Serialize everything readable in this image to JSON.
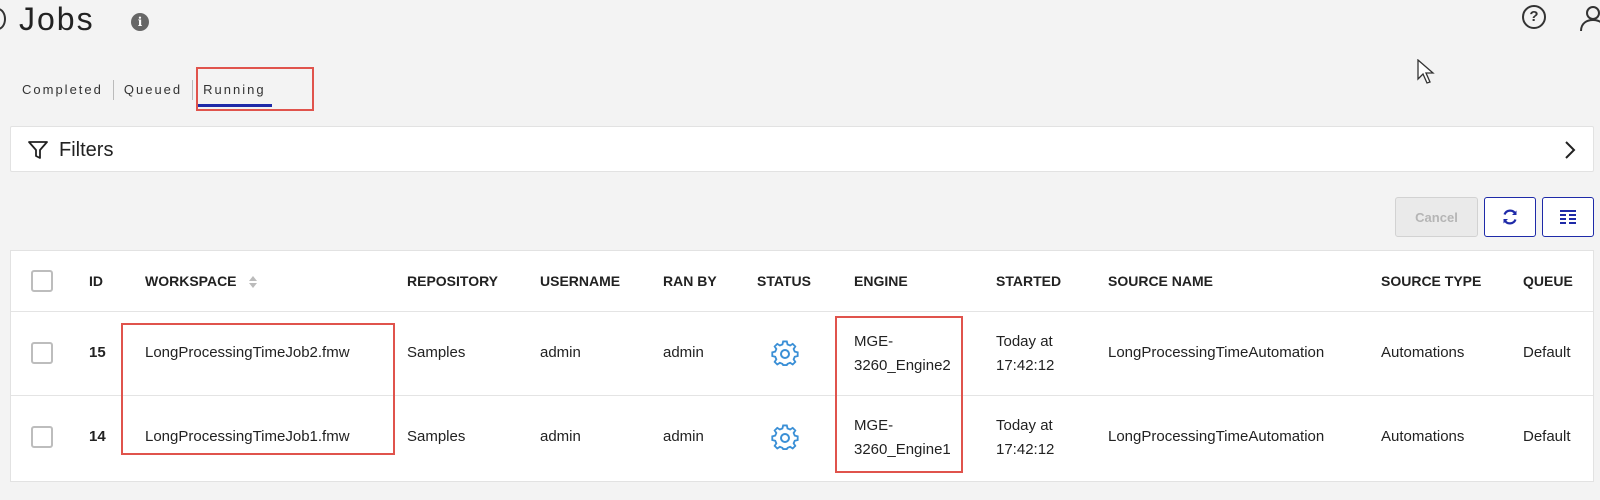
{
  "header": {
    "title": "Jobs",
    "info_icon": "info-icon",
    "help_icon": "help-icon",
    "user_icon": "user-icon"
  },
  "tabs": [
    {
      "label": "Completed",
      "active": false
    },
    {
      "label": "Queued",
      "active": false
    },
    {
      "label": "Running",
      "active": true
    }
  ],
  "filters": {
    "label": "Filters",
    "icon": "filter-icon",
    "expand_icon": "chevron-right-icon"
  },
  "toolbar": {
    "cancel_label": "Cancel",
    "refresh_icon": "refresh-icon",
    "columns_icon": "columns-icon"
  },
  "table": {
    "columns": [
      "ID",
      "WORKSPACE",
      "REPOSITORY",
      "USERNAME",
      "RAN BY",
      "STATUS",
      "ENGINE",
      "STARTED",
      "SOURCE NAME",
      "SOURCE TYPE",
      "QUEUE"
    ],
    "rows": [
      {
        "id": "15",
        "workspace": "LongProcessingTimeJob2.fmw",
        "repository": "Samples",
        "username": "admin",
        "ran_by": "admin",
        "status_icon": "gear-icon",
        "engine_line1": "MGE-",
        "engine_line2": "3260_Engine2",
        "started_line1": "Today at",
        "started_line2": "17:42:12",
        "source_name": "LongProcessingTimeAutomation",
        "source_type": "Automations",
        "queue": "Default"
      },
      {
        "id": "14",
        "workspace": "LongProcessingTimeJob1.fmw",
        "repository": "Samples",
        "username": "admin",
        "ran_by": "admin",
        "status_icon": "gear-icon",
        "engine_line1": "MGE-",
        "engine_line2": "3260_Engine1",
        "started_line1": "Today at",
        "started_line2": "17:42:12",
        "source_name": "LongProcessingTimeAutomation",
        "source_type": "Automations",
        "queue": "Default"
      }
    ]
  },
  "colors": {
    "accent": "#1e2aa8",
    "highlight": "#e0534c",
    "status_gear": "#3a8fd6"
  }
}
